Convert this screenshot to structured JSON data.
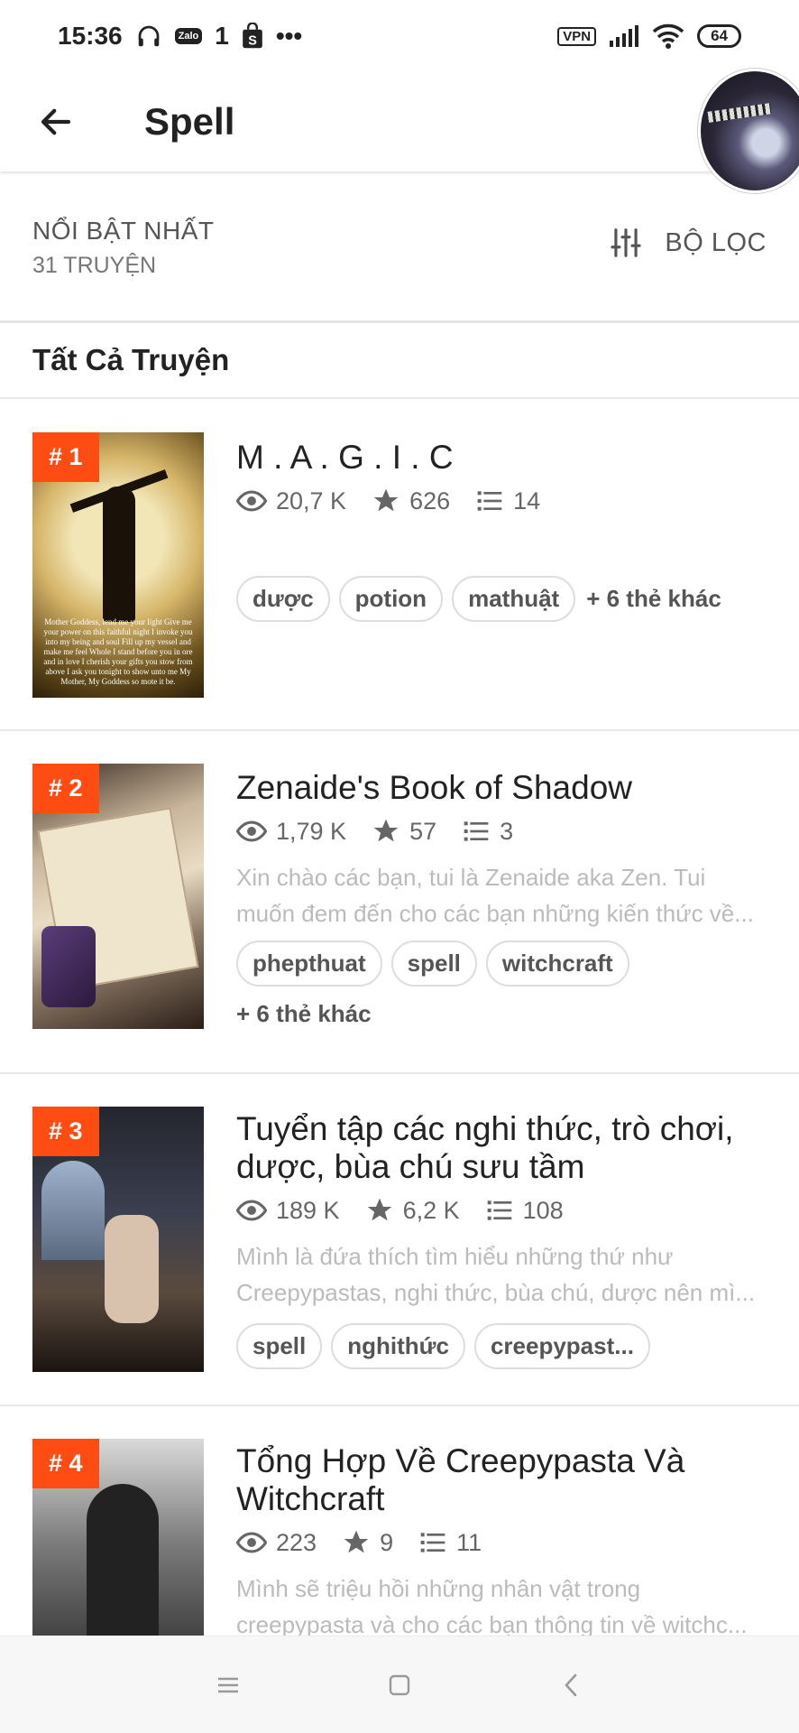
{
  "status_bar": {
    "time": "15:36",
    "notif_zalo": "Zalo",
    "notif_one": "1",
    "notif_dots": "•••",
    "vpn": "VPN",
    "battery": "64"
  },
  "app_bar": {
    "title": "Spell"
  },
  "filter_bar": {
    "sort_label": "NỔI BẬT NHẤT",
    "count_label": "31 TRUYỆN",
    "filter_label": "BỘ LỌC"
  },
  "section": {
    "title": "Tất Cả Truyện"
  },
  "stories": [
    {
      "rank": "# 1",
      "title": "M . A . G . I . C",
      "views": "20,7 K",
      "votes": "626",
      "parts": "14",
      "description": [],
      "tags": [
        "dược",
        "potion",
        "mathuật"
      ],
      "more_tags": "+ 6 thẻ khác",
      "cover_caption": "Mother Goddess, lend me your light Give me your power on this faithful night I invoke you into my being and soul Fill up my vessel and make me feel Whole I stand before you in ore and in love I cherish your gifts you stow from above I ask you tonight to show unto me My Mother, My Goddess so mote it be."
    },
    {
      "rank": "# 2",
      "title": "Zenaide's Book of Shadow",
      "views": "1,79 K",
      "votes": "57",
      "parts": "3",
      "description": [
        "Xin chào các bạn, tui là Zenaide aka Zen. Tui",
        "muốn đem đến cho các bạn những kiến thức về..."
      ],
      "tags": [
        "phepthuat",
        "spell",
        "witchcraft"
      ],
      "more_tags": "+ 6 thẻ khác"
    },
    {
      "rank": "# 3",
      "title": "Tuyển tập các nghi thức, trò chơi, dược, bùa chú sưu tầm",
      "views": "189 K",
      "votes": "6,2 K",
      "parts": "108",
      "description": [
        "Mình là đứa thích tìm hiểu những thứ như",
        "Creepypastas, nghi thức, bùa chú, dược nên mì..."
      ],
      "tags": [
        "spell",
        "nghithức",
        "creepypast..."
      ]
    },
    {
      "rank": "# 4",
      "title": "Tổng Hợp Về Creepypasta Và Witchcraft",
      "views": "223",
      "votes": "9",
      "parts": "11",
      "description": [
        "Mình sẽ triệu hồi những nhân vật trong",
        "creepypasta và cho các bạn thông tin về witchc..."
      ]
    }
  ],
  "icons": {
    "back": "arrow-left",
    "filter": "sliders",
    "views": "eye",
    "votes": "star",
    "parts": "list"
  },
  "colors": {
    "accent": "#ff4c12",
    "text": "#222222",
    "muted": "#666666"
  }
}
